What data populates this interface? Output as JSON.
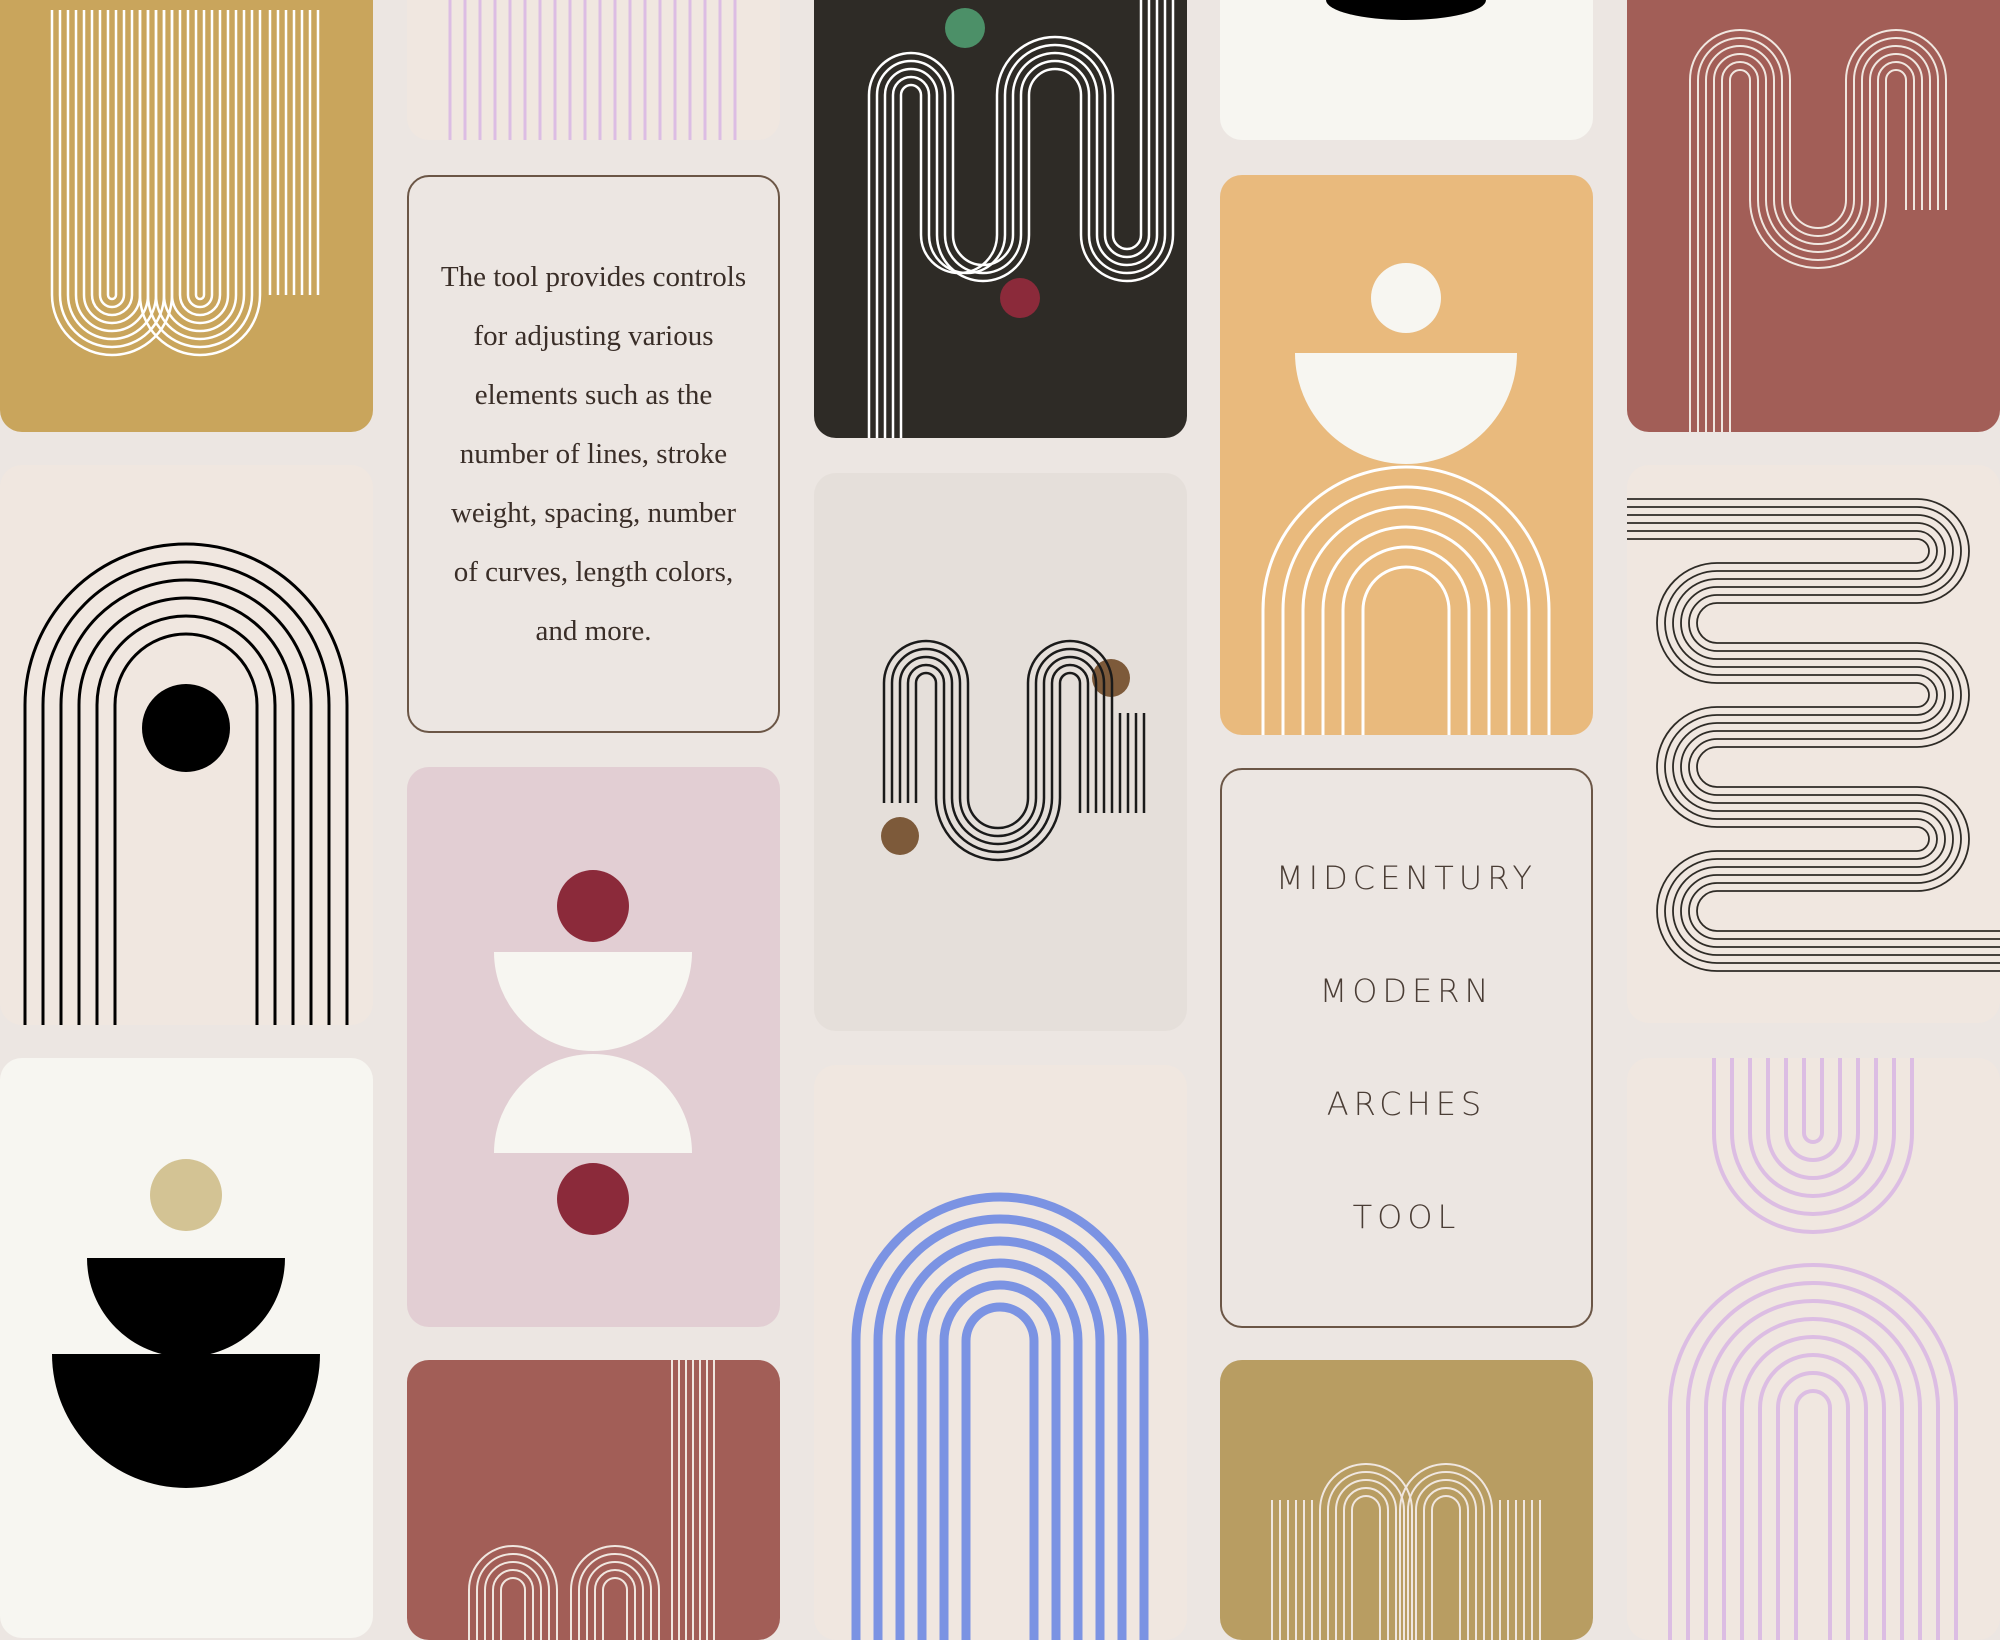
{
  "title_card": {
    "lines": [
      "MIDCENTURY",
      "MODERN",
      "ARCHES",
      "TOOL"
    ]
  },
  "description_card": {
    "text": "The tool provides controls for adjusting various elements such as the number of lines, stroke weight, spacing, number of curves, length colors, and more."
  },
  "colors": {
    "background": "#ece6e2",
    "mustard": "#c9a55c",
    "cream": "#f0e7e0",
    "offwhite": "#f7f6f1",
    "dark": "#2e2b26",
    "lilac": "#dcbde3",
    "pink": "#e2ced3",
    "brick": "#a25e57",
    "apricot": "#e9ba7d",
    "olive": "#b89d62",
    "blue": "#7b93e3",
    "burgundy": "#8b2a3a",
    "brown": "#7d5a3a",
    "green": "#4c9068",
    "sand": "#d3c394"
  }
}
